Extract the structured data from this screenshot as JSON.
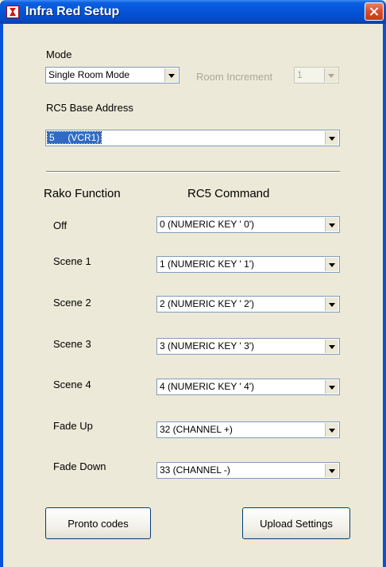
{
  "window": {
    "title": "Infra Red Setup"
  },
  "mode": {
    "label": "Mode",
    "value": "Single Room Mode"
  },
  "room_increment": {
    "label": "Room Increment",
    "value": "1"
  },
  "base_address": {
    "label": "RC5 Base Address",
    "value": "5     (VCR1)"
  },
  "headers": {
    "function": "Rako Function",
    "command": "RC5 Command"
  },
  "rows": [
    {
      "label": "Off",
      "command": "0 (NUMERIC KEY ' 0')"
    },
    {
      "label": "Scene 1",
      "command": "1 (NUMERIC KEY ' 1')"
    },
    {
      "label": "Scene 2",
      "command": "2 (NUMERIC KEY ' 2')"
    },
    {
      "label": "Scene 3",
      "command": "3 (NUMERIC KEY ' 3')"
    },
    {
      "label": "Scene 4",
      "command": "4 (NUMERIC KEY ' 4')"
    },
    {
      "label": "Fade Up",
      "command": "32 (CHANNEL +)"
    },
    {
      "label": "Fade Down",
      "command": "33 (CHANNEL -)"
    }
  ],
  "buttons": {
    "pronto": "Pronto codes",
    "upload": "Upload Settings"
  }
}
